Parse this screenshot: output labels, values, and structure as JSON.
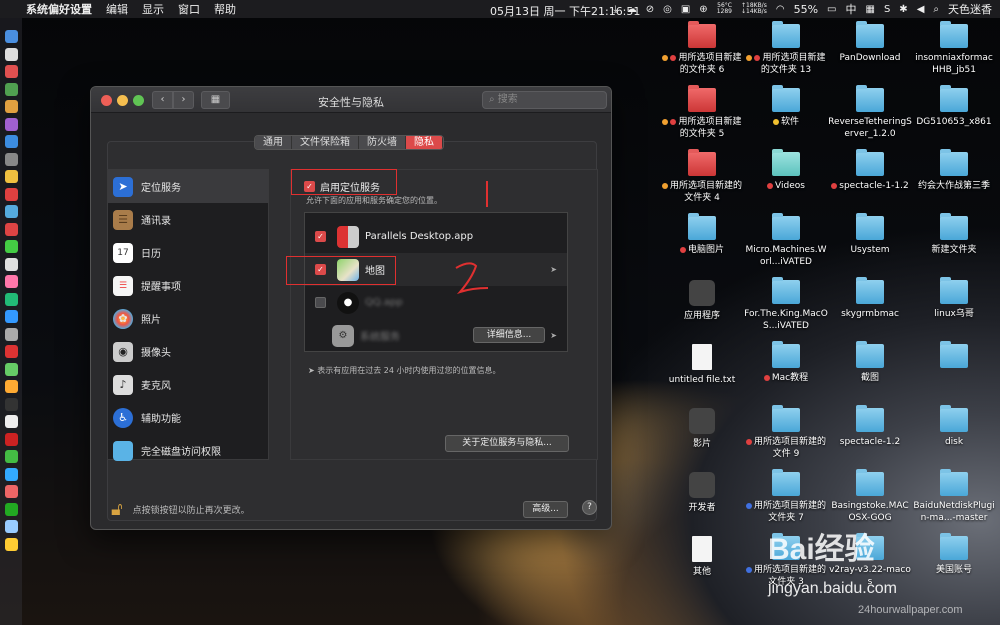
{
  "menubar": {
    "app_name": "系统偏好设置",
    "menus": [
      "编辑",
      "显示",
      "窗口",
      "帮助"
    ],
    "temp": "56°C",
    "fan": "1289",
    "net_up": "↑18KB/s",
    "net_down": "↓14KB/s",
    "datetime": "05月13日 周一 下午21:16:51",
    "battery": "55%",
    "input_method": "中",
    "user": "天色迷香"
  },
  "window": {
    "title": "安全性与隐私",
    "search_placeholder": "搜索",
    "nav_back": "‹",
    "nav_forward": "›",
    "grid_icon": "▦",
    "tabs": [
      "通用",
      "文件保险箱",
      "防火墙",
      "隐私"
    ],
    "active_tab": "隐私",
    "sidebar": [
      {
        "label": "定位服务",
        "icon": "location-arrow"
      },
      {
        "label": "通讯录",
        "icon": "contacts"
      },
      {
        "label": "日历",
        "icon": "calendar"
      },
      {
        "label": "提醒事项",
        "icon": "reminders"
      },
      {
        "label": "照片",
        "icon": "photos"
      },
      {
        "label": "摄像头",
        "icon": "camera"
      },
      {
        "label": "麦克风",
        "icon": "microphone"
      },
      {
        "label": "辅助功能",
        "icon": "accessibility"
      },
      {
        "label": "完全磁盘访问权限",
        "icon": "folder"
      }
    ],
    "enable_location": "启用定位服务",
    "enable_desc": "允许下面的应用和服务确定您的位置。",
    "apps": [
      {
        "name": "Parallels Desktop.app",
        "checked": true
      },
      {
        "name": "地图",
        "checked": true
      },
      {
        "name": "QQ.app",
        "checked": false
      },
      {
        "name": "系统服务",
        "checked": false
      }
    ],
    "details_button": "详细信息...",
    "hint": "表示有应用在过去 24 小时内使用过您的位置信息。",
    "about_button": "关于定位服务与隐私...",
    "lock_text": "点按锁按钮以防止再次更改。",
    "advanced_button": "高级...",
    "help_button": "?"
  },
  "desktop_icons": [
    {
      "label": "用所选项目新建的文件夹 6",
      "type": "red",
      "dots": [
        "#f0a030",
        "#e04040"
      ]
    },
    {
      "label": "用所选项目新建的文件夹 13",
      "type": "folder",
      "dots": [
        "#f0a030",
        "#e04040"
      ]
    },
    {
      "label": "PanDownload",
      "type": "folder",
      "dots": []
    },
    {
      "label": "insomniaxformacHHB_jb51",
      "type": "folder",
      "dots": []
    },
    {
      "label": "用所选项目新建的文件夹 5",
      "type": "red",
      "dots": [
        "#f0a030",
        "#e04040"
      ]
    },
    {
      "label": "软件",
      "type": "folder",
      "dots": [
        "#f0c030"
      ]
    },
    {
      "label": "ReverseTetheringServer_1.2.0",
      "type": "folder",
      "dots": []
    },
    {
      "label": "DG510653_x861",
      "type": "folder",
      "dots": []
    },
    {
      "label": "用所选项目新建的文件夹 4",
      "type": "red",
      "dots": [
        "#f0a030"
      ]
    },
    {
      "label": "Videos",
      "type": "teal",
      "dots": [
        "#e04040"
      ]
    },
    {
      "label": "spectacle-1-1.2",
      "type": "folder",
      "dots": [
        "#e04040"
      ]
    },
    {
      "label": "约会大作战第三季",
      "type": "folder",
      "dots": []
    },
    {
      "label": "电脑图片",
      "type": "folder",
      "dots": [
        "#e04040"
      ]
    },
    {
      "label": "Micro.Machines.Worl...iVATED",
      "type": "folder",
      "dots": []
    },
    {
      "label": "Usystem",
      "type": "folder",
      "dots": []
    },
    {
      "label": "新建文件夹",
      "type": "folder",
      "dots": []
    },
    {
      "label": "应用程序",
      "type": "app",
      "dots": []
    },
    {
      "label": "For.The.King.MacOS...iVATED",
      "type": "folder",
      "dots": []
    },
    {
      "label": "skygrmbmac",
      "type": "folder",
      "dots": []
    },
    {
      "label": "linux乌哥",
      "type": "folder",
      "dots": []
    },
    {
      "label": "untitled file.txt",
      "type": "file",
      "dots": []
    },
    {
      "label": "Mac教程",
      "type": "folder",
      "dots": [
        "#e04040"
      ]
    },
    {
      "label": "截图",
      "type": "folder",
      "dots": []
    },
    {
      "label": "",
      "type": "folder",
      "dots": []
    },
    {
      "label": "影片",
      "type": "app",
      "dots": []
    },
    {
      "label": "用所选项目新建的文件 9",
      "type": "folder",
      "dots": [
        "#e04040"
      ]
    },
    {
      "label": "spectacle-1.2",
      "type": "folder",
      "dots": []
    },
    {
      "label": "disk",
      "type": "folder",
      "dots": []
    },
    {
      "label": "开发者",
      "type": "app",
      "dots": []
    },
    {
      "label": "用所选项目新建的文件夹 7",
      "type": "folder",
      "dots": [
        "#4070e0"
      ]
    },
    {
      "label": "Basingstoke.MACOSX-GOG",
      "type": "folder",
      "dots": []
    },
    {
      "label": "BaiduNetdiskPlugin-ma...-master",
      "type": "folder",
      "dots": []
    },
    {
      "label": "其他",
      "type": "file",
      "dots": []
    },
    {
      "label": "用所选项目新建的文件夹 3",
      "type": "folder",
      "dots": [
        "#4070e0"
      ]
    },
    {
      "label": "v2ray-v3.22-macos",
      "type": "folder",
      "dots": []
    },
    {
      "label": "美国账号",
      "type": "folder",
      "dots": []
    }
  ],
  "watermark": {
    "brand": "Bai经验",
    "url": "jingyan.baidu.com",
    "site": "24hourwallpaper.com"
  },
  "colors": {
    "accent": "#dc4a4a",
    "annotation": "#e03030",
    "close": "#ee5f57",
    "minimize": "#f5be4f",
    "zoom": "#60c454"
  }
}
